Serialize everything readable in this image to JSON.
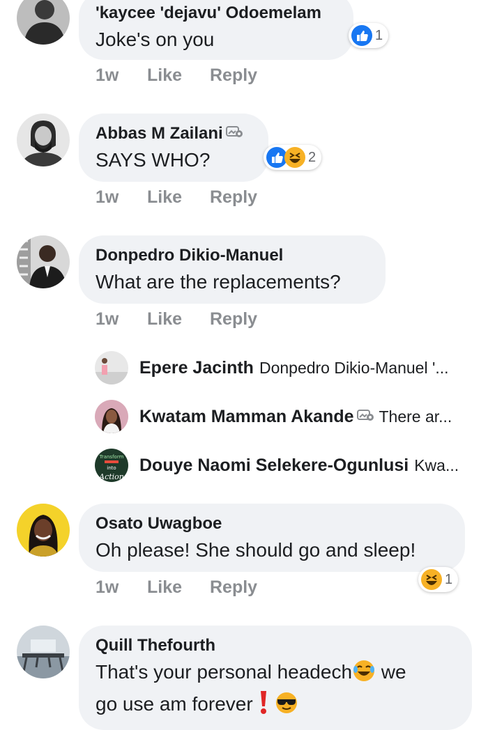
{
  "comments": [
    {
      "author": "'kaycee 'dejavu' Odoemelam",
      "text": "Joke's on you",
      "time": "1w",
      "like": "Like",
      "reply": "Reply",
      "reactions": [
        "like"
      ],
      "reaction_count": "1"
    },
    {
      "author": "Abbas M Zailani",
      "text": "SAYS WHO?",
      "time": "1w",
      "like": "Like",
      "reply": "Reply",
      "reactions": [
        "like",
        "haha"
      ],
      "reaction_count": "2",
      "badge": "top-fan-icon"
    },
    {
      "author": "Donpedro Dikio-Manuel",
      "text": "What are the replacements?",
      "time": "1w",
      "like": "Like",
      "reply": "Reply"
    },
    {
      "author": "Osato Uwagboe",
      "text": "Oh please! She should go and sleep!",
      "time": "1w",
      "like": "Like",
      "reply": "Reply",
      "reactions": [
        "haha"
      ],
      "reaction_count": "1"
    },
    {
      "author": "Quill Thefourth",
      "text_line1": "That's your personal headech",
      "text_line1_after": " we",
      "text_line2": "go use am forever"
    }
  ],
  "replies": [
    {
      "name": "Epere Jacinth",
      "preview": "Donpedro Dikio-Manuel  '..."
    },
    {
      "name": "Kwatam Mamman Akande",
      "preview": "There ar...",
      "badge": "top-fan-icon"
    },
    {
      "name": "Douye Naomi Selekere-Ogunlusi",
      "preview": "Kwa..."
    }
  ],
  "avatar_texts": {
    "douye_line1": "Transform",
    "douye_line2": "into",
    "douye_line3": "Action"
  },
  "colors": {
    "bubble": "#f0f2f5",
    "meta": "#8a8d91",
    "like_blue": "#1877f2",
    "haha_yellow": "#f7b125"
  }
}
